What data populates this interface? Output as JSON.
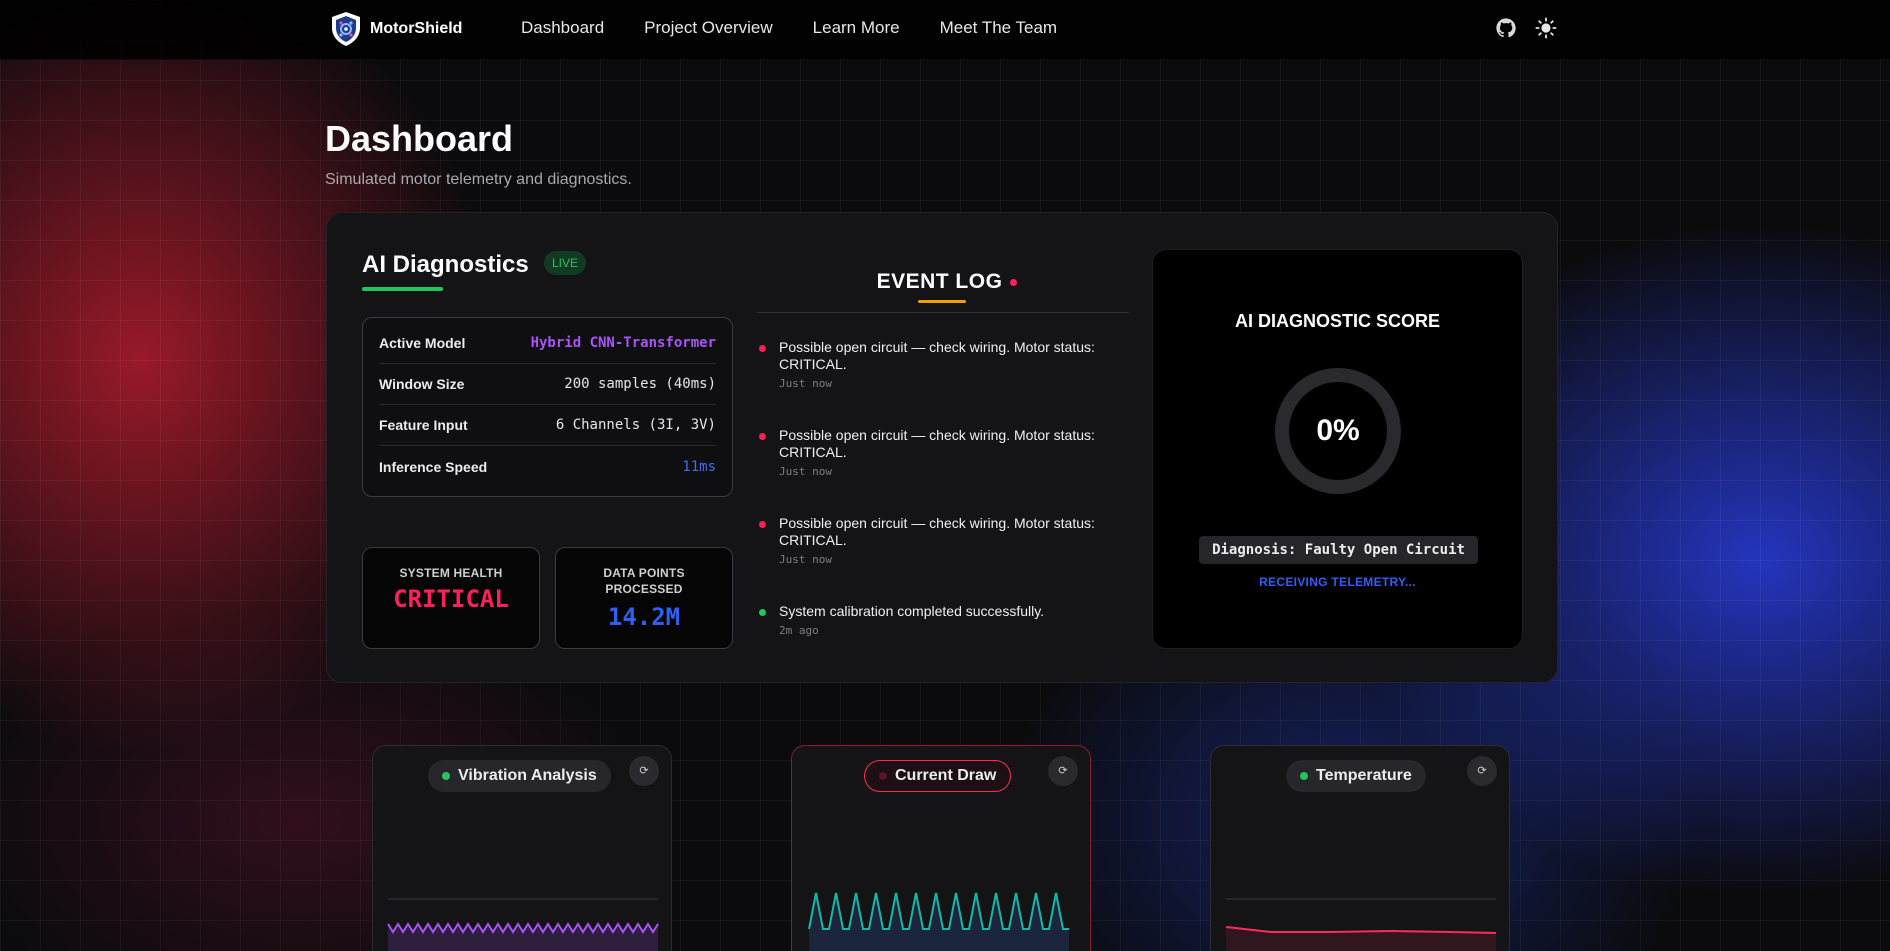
{
  "nav": {
    "brand": "MotorShield",
    "links": [
      "Dashboard",
      "Project Overview",
      "Learn More",
      "Meet The Team"
    ],
    "icons": [
      "github-icon",
      "theme-toggle-icon"
    ]
  },
  "header": {
    "title": "Dashboard",
    "subtitle": "Simulated motor telemetry and diagnostics."
  },
  "diagnostics": {
    "title": "AI Diagnostics",
    "badge": "LIVE",
    "specs": [
      {
        "label": "Active Model",
        "value": "Hybrid CNN-Transformer"
      },
      {
        "label": "Window Size",
        "value": "200 samples (40ms)"
      },
      {
        "label": "Feature Input",
        "value": "6 Channels (3I, 3V)"
      },
      {
        "label": "Inference Speed",
        "value": "11ms"
      }
    ],
    "stats": [
      {
        "label": "SYSTEM HEALTH",
        "value": "CRITICAL",
        "color": "#ff1f5a"
      },
      {
        "label": "DATA POINTS PROCESSED",
        "value": "14.2M",
        "color": "#2f5ff5"
      }
    ]
  },
  "event_log": {
    "title": "EVENT LOG",
    "items": [
      {
        "message": "Possible open circuit — check wiring. Motor status: CRITICAL.",
        "time": "Just now",
        "status_color": "#ff1f5a"
      },
      {
        "message": "Possible open circuit — check wiring. Motor status: CRITICAL.",
        "time": "Just now",
        "status_color": "#ff1f5a"
      },
      {
        "message": "Possible open circuit — check wiring. Motor status: CRITICAL.",
        "time": "Just now",
        "status_color": "#ff1f5a"
      },
      {
        "message": "System calibration completed successfully.",
        "time": "2m ago",
        "status_color": "#22c55e"
      }
    ]
  },
  "score": {
    "title": "AI DIAGNOSTIC SCORE",
    "value": "0%",
    "diagnosis": "Diagnosis: Faulty Open Circuit",
    "status": "RECEIVING TELEMETRY..."
  },
  "cards": [
    {
      "title": "Vibration Analysis",
      "status_color": "#22c55e",
      "line_color": "#a855f7",
      "alert": false
    },
    {
      "title": "Current Draw",
      "status_color": "#5a1424",
      "line_color": "#14b8a6",
      "alert": true
    },
    {
      "title": "Temperature",
      "status_color": "#22c55e",
      "line_color": "#ff2a5a",
      "alert": false
    }
  ]
}
